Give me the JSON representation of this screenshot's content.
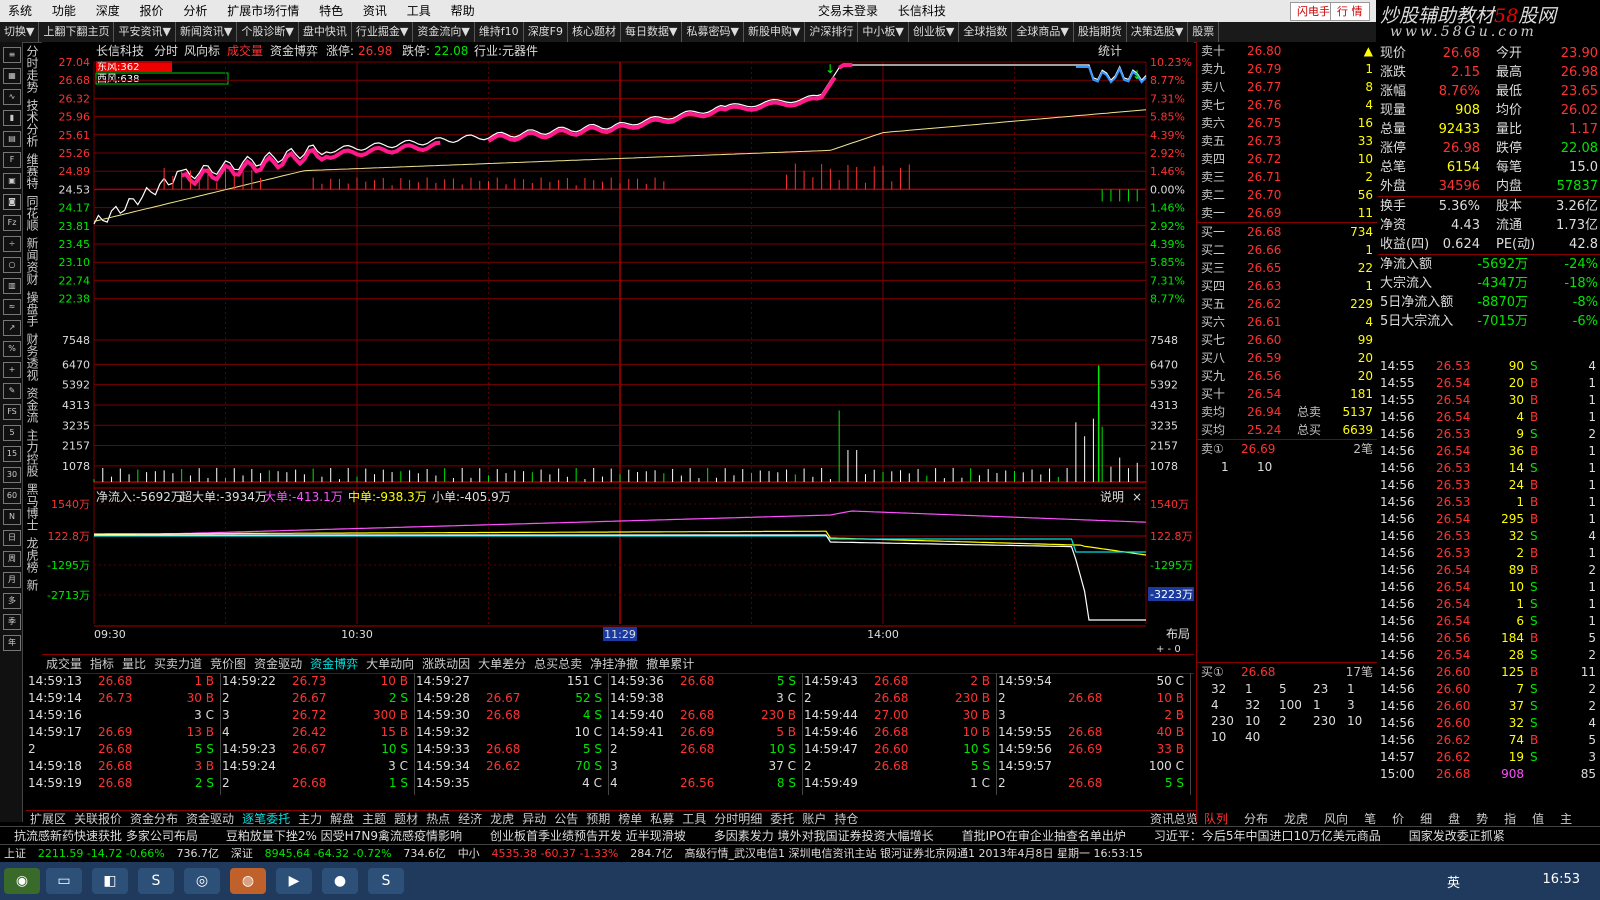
{
  "menu": {
    "items": [
      "系统",
      "功能",
      "深度",
      "报价",
      "分析",
      "扩展市场行情",
      "特色",
      "资讯",
      "工具",
      "帮助"
    ],
    "center": [
      "交易未登录",
      "长信科技"
    ],
    "flash_button": "闪电手",
    "quote_button": "行 情"
  },
  "logo": {
    "line1a": "炒股辅助教材",
    "line1b": "58",
    "line1c": "股网",
    "line2": "www.58Gu.com"
  },
  "toolbar": [
    "切换▼",
    "上翻下翻主页",
    "平安资讯▼",
    "新闻资讯▼",
    "个股诊断▼",
    "盘中快讯",
    "行业掘金▼",
    "资金流向▼",
    "维持f10",
    "深度F9",
    "核心题材",
    "每日数据▼",
    "私募密码▼",
    "新股申购▼",
    "沪深排行",
    "中小板▼",
    "创业板▼",
    "全球指数",
    "全球商品▼",
    "股指期货",
    "决策选股▼",
    "股票"
  ],
  "left_vtabs": [
    "分时走势",
    "技术分析",
    "维赛特",
    "同花顺",
    "新闻资财",
    "操盘手",
    "财务透视",
    "资金流",
    "主力控股",
    "黑马博士",
    "龙虎榜",
    "新"
  ],
  "chart": {
    "title": "长信科技",
    "header_items": [
      "分时",
      "风向标",
      "成交量",
      "资金博弈"
    ],
    "limit_up_label": "涨停:",
    "limit_up": "26.98",
    "limit_down_label": "跌停:",
    "limit_down": "22.08",
    "industry": "行业:元器件",
    "stat_label": "统计",
    "dongfeng": "东风:362",
    "xifeng": "西风:638",
    "price_ticks": [
      "27.04",
      "26.68",
      "26.32",
      "25.96",
      "25.61",
      "25.26",
      "24.89",
      "24.53",
      "24.17",
      "23.81",
      "23.45",
      "23.10",
      "22.74",
      "22.38"
    ],
    "pct_ticks": [
      "10.23%",
      "8.77%",
      "7.31%",
      "5.85%",
      "4.39%",
      "2.92%",
      "1.46%",
      "0.00%",
      "1.46%",
      "2.92%",
      "4.39%",
      "5.85%",
      "7.31%",
      "8.77%"
    ],
    "vol_ticks": [
      "7548",
      "6470",
      "5392",
      "4313",
      "3235",
      "2157",
      "1078"
    ],
    "flow_header": [
      {
        "label": "净流入:-5692万",
        "color": "#dddddd"
      },
      {
        "label": "超大单:-3934万",
        "color": "#dddddd"
      },
      {
        "label": "大单:-413.1万",
        "color": "#ff50ff"
      },
      {
        "label": "中单:-938.3万",
        "color": "#ffff00"
      },
      {
        "label": "小单:-405.9万",
        "color": "#dddddd"
      }
    ],
    "flow_explain": "说明",
    "flow_ticks": [
      "1540万",
      "122.8万",
      "-1295万",
      "-2713万"
    ],
    "flow_right_last": "-3223万",
    "time_labels": [
      "09:30",
      "10:30",
      "11:29",
      "14:00"
    ],
    "layout_label": "布局"
  },
  "bottom_tabs": [
    "成交量",
    "指标",
    "量比",
    "买卖力道",
    "竞价图",
    "资金驱动",
    "资金博弈",
    "大单动向",
    "涨跌动因",
    "大单差分",
    "总买总卖",
    "净挂净撤",
    "撤单累计"
  ],
  "trades": [
    [
      [
        "14:59:13",
        "26.68",
        "1 B"
      ],
      [
        "14:59:14",
        "26.73",
        "30 B"
      ],
      [
        "14:59:16",
        "",
        "3 C"
      ],
      [
        "14:59:17",
        "26.69",
        "13 B"
      ],
      [
        "2",
        "26.68",
        "5 S"
      ],
      [
        "14:59:18",
        "26.68",
        "3 B"
      ],
      [
        "14:59:19",
        "26.68",
        "2 S"
      ]
    ],
    [
      [
        "14:59:22",
        "26.73",
        "10 B"
      ],
      [
        "2",
        "26.67",
        "2 S"
      ],
      [
        "3",
        "26.72",
        "300 B"
      ],
      [
        "4",
        "26.42",
        "15 B"
      ],
      [
        "14:59:23",
        "26.67",
        "10 S"
      ],
      [
        "14:59:24",
        "",
        "3 C"
      ],
      [
        "2",
        "26.68",
        "1 S"
      ]
    ],
    [
      [
        "14:59:27",
        "",
        "151 C"
      ],
      [
        "14:59:28",
        "26.67",
        "52 S"
      ],
      [
        "14:59:30",
        "26.68",
        "4 S"
      ],
      [
        "14:59:32",
        "",
        "10 C"
      ],
      [
        "14:59:33",
        "26.68",
        "5 S"
      ],
      [
        "14:59:34",
        "26.62",
        "70 S"
      ],
      [
        "14:59:35",
        "",
        "4 C"
      ]
    ],
    [
      [
        "14:59:36",
        "26.68",
        "5 S"
      ],
      [
        "14:59:38",
        "",
        "3 C"
      ],
      [
        "14:59:40",
        "26.68",
        "230 B"
      ],
      [
        "14:59:41",
        "26.69",
        "5 B"
      ],
      [
        "2",
        "26.68",
        "10 S"
      ],
      [
        "3",
        "",
        "37 C"
      ],
      [
        "4",
        "26.56",
        "8 S"
      ]
    ],
    [
      [
        "14:59:43",
        "26.68",
        "2 B"
      ],
      [
        "2",
        "26.68",
        "230 B"
      ],
      [
        "14:59:44",
        "27.00",
        "30 B"
      ],
      [
        "14:59:46",
        "26.68",
        "10 B"
      ],
      [
        "14:59:47",
        "26.60",
        "10 S"
      ],
      [
        "2",
        "26.68",
        "5 S"
      ],
      [
        "14:59:49",
        "",
        "1 C"
      ]
    ],
    [
      [
        "14:59:54",
        "",
        "50 C"
      ],
      [
        "2",
        "26.68",
        "10 B"
      ],
      [
        "3",
        "",
        "2 B"
      ],
      [
        "14:59:55",
        "26.68",
        "40 B"
      ],
      [
        "14:59:56",
        "26.69",
        "33 B"
      ],
      [
        "14:59:57",
        "",
        "100 C"
      ],
      [
        "2",
        "26.68",
        "5 S"
      ]
    ]
  ],
  "bottom_tabs2": [
    "扩展区",
    "关联报价",
    "资金分布",
    "资金驱动",
    "逐笔委托",
    "主力",
    "解盘",
    "主题",
    "题材",
    "热点",
    "经济",
    "龙虎",
    "异动",
    "公告",
    "预期",
    "榜单",
    "私募",
    "工具",
    "分时明细",
    "委托",
    "账户",
    "持仓"
  ],
  "info_label": "资讯总览",
  "right_tabs": [
    "队列",
    "分布",
    "龙虎",
    "风向"
  ],
  "right_tabs2": [
    "笔",
    "价",
    "细",
    "盘",
    "势",
    "指",
    "值",
    "主"
  ],
  "orderbook": {
    "sells": [
      [
        "卖十",
        "26.80",
        "▲"
      ],
      [
        "卖九",
        "26.79",
        "1"
      ],
      [
        "卖八",
        "26.77",
        "8"
      ],
      [
        "卖七",
        "26.76",
        "4"
      ],
      [
        "卖六",
        "26.75",
        "16"
      ],
      [
        "卖五",
        "26.73",
        "33"
      ],
      [
        "卖四",
        "26.72",
        "10"
      ],
      [
        "卖三",
        "26.71",
        "2"
      ],
      [
        "卖二",
        "26.70",
        "56"
      ],
      [
        "卖一",
        "26.69",
        "11"
      ]
    ],
    "buys": [
      [
        "买一",
        "26.68",
        "734"
      ],
      [
        "买二",
        "26.66",
        "1"
      ],
      [
        "买三",
        "26.65",
        "22"
      ],
      [
        "买四",
        "26.63",
        "1"
      ],
      [
        "买五",
        "26.62",
        "229"
      ],
      [
        "买六",
        "26.61",
        "4"
      ],
      [
        "买七",
        "26.60",
        "99"
      ],
      [
        "买八",
        "26.59",
        "20"
      ],
      [
        "买九",
        "26.56",
        "20"
      ],
      [
        "买十",
        "26.54",
        "181"
      ]
    ],
    "sell_avg": [
      "卖均",
      "26.94",
      "总卖",
      "5137"
    ],
    "buy_avg": [
      "买均",
      "25.24",
      "总买",
      "6639"
    ],
    "sell_queue": [
      "卖①",
      "26.69",
      "2笔"
    ],
    "sell_queue_vals": [
      "1",
      "10"
    ],
    "buy_queue": [
      "买①",
      "26.68",
      "17笔"
    ],
    "buy_queue_rows": [
      [
        "32",
        "1",
        "5",
        "23",
        "1"
      ],
      [
        "4",
        "32",
        "100",
        "1",
        "3"
      ],
      [
        "230",
        "10",
        "2",
        "230",
        "10"
      ],
      [
        "10",
        "40"
      ]
    ]
  },
  "stats": [
    [
      "现价",
      "26.68",
      "今开",
      "23.90"
    ],
    [
      "涨跌",
      "2.15",
      "最高",
      "26.98"
    ],
    [
      "涨幅",
      "8.76%",
      "最低",
      "23.65"
    ],
    [
      "现量",
      "908",
      "均价",
      "26.02"
    ],
    [
      "总量",
      "92433",
      "量比",
      "1.17"
    ],
    [
      "涨停",
      "26.98",
      "跌停",
      "22.08"
    ],
    [
      "总笔",
      "6154",
      "每笔",
      "15.0"
    ],
    [
      "外盘",
      "34596",
      "内盘",
      "57837"
    ],
    [
      "换手",
      "5.36%",
      "股本",
      "3.26亿"
    ],
    [
      "净资",
      "4.43",
      "流通",
      "1.73亿"
    ],
    [
      "收益(四)",
      "0.624",
      "PE(动)",
      "42.8"
    ],
    [
      "净流入额",
      "-5692万",
      "",
      "-24%"
    ],
    [
      "大宗流入",
      "-4347万",
      "",
      "-18%"
    ],
    [
      "5日净流入额",
      "-8870万",
      "",
      "-8%"
    ],
    [
      "5日大宗流入",
      "-7015万",
      "",
      "-6%"
    ]
  ],
  "ticks": [
    [
      "14:55",
      "26.53",
      "90",
      "S",
      "4"
    ],
    [
      "14:55",
      "26.54",
      "20",
      "B",
      "1"
    ],
    [
      "14:55",
      "26.54",
      "30",
      "B",
      "1"
    ],
    [
      "14:56",
      "26.54",
      "4",
      "B",
      "1"
    ],
    [
      "14:56",
      "26.53",
      "9",
      "S",
      "2"
    ],
    [
      "14:56",
      "26.54",
      "36",
      "B",
      "1"
    ],
    [
      "14:56",
      "26.53",
      "14",
      "S",
      "1"
    ],
    [
      "14:56",
      "26.53",
      "24",
      "B",
      "1"
    ],
    [
      "14:56",
      "26.53",
      "1",
      "B",
      "1"
    ],
    [
      "14:56",
      "26.54",
      "295",
      "B",
      "1"
    ],
    [
      "14:56",
      "26.53",
      "32",
      "S",
      "4"
    ],
    [
      "14:56",
      "26.53",
      "2",
      "B",
      "1"
    ],
    [
      "14:56",
      "26.54",
      "89",
      "B",
      "2"
    ],
    [
      "14:56",
      "26.54",
      "10",
      "S",
      "1"
    ],
    [
      "14:56",
      "26.54",
      "1",
      "S",
      "1"
    ],
    [
      "14:56",
      "26.54",
      "6",
      "S",
      "1"
    ],
    [
      "14:56",
      "26.56",
      "184",
      "B",
      "5"
    ],
    [
      "14:56",
      "26.54",
      "28",
      "S",
      "2"
    ],
    [
      "14:56",
      "26.60",
      "125",
      "B",
      "11"
    ],
    [
      "14:56",
      "26.60",
      "7",
      "S",
      "2"
    ],
    [
      "14:56",
      "26.60",
      "37",
      "S",
      "2"
    ],
    [
      "14:56",
      "26.60",
      "32",
      "S",
      "4"
    ],
    [
      "14:56",
      "26.62",
      "74",
      "B",
      "5"
    ],
    [
      "14:57",
      "26.62",
      "19",
      "S",
      "3"
    ],
    [
      "15:00",
      "26.68",
      "908",
      "",
      "85"
    ]
  ],
  "news": [
    "抗流感新药快速获批 多家公司布局",
    "豆粕放量下挫2% 因受H7N9禽流感疫情影响",
    "创业板首季业绩预告开发 近半现滑坡",
    "多因素发力 境外对我国证券投资大幅增长",
    "首批IPO在审企业抽查名单出炉",
    "习近平：今后5年中国进口10万亿美元商品",
    "国家发改委正抓紧"
  ],
  "indexbar": {
    "sh_label": "上证",
    "sh_vals": "2211.59 -14.72 -0.66%",
    "sh_amt": "736.7亿",
    "sz_label": "深证",
    "sz_vals": "8945.64 -64.32 -0.72%",
    "sz_amt": "734.6亿",
    "zx_label": "中小",
    "zx_vals": "4535.38 -60.37 -1.33%",
    "zx_amt": "284.7亿",
    "status": "高级行情_武汉电信1 深圳电信资讯主站 银河证券北京网通1 2013年4月8日 星期一 16:53:15"
  },
  "taskbar": {
    "lang": "英",
    "clock": "16:53"
  }
}
